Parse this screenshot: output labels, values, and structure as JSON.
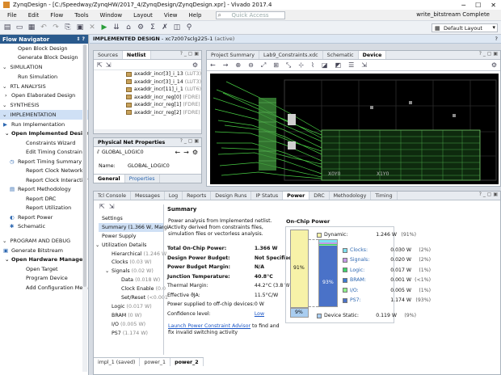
{
  "window": {
    "title": "ZynqDesign - [C:/Speedway/ZynqHW/2017_4/ZynqDesign/ZynqDesign.xpr] - Vivado 2017.4"
  },
  "menu": [
    "File",
    "Edit",
    "Flow",
    "Tools",
    "Window",
    "Layout",
    "View",
    "Help"
  ],
  "quick_access_placeholder": "Quick Access",
  "status_top": "write_bitstream Complete",
  "layout_select": "Default Layout",
  "flow_navigator": {
    "title": "Flow Navigator",
    "items": [
      {
        "label": "Open Block Design",
        "kind": "item",
        "indent": 22
      },
      {
        "label": "Generate Block Design",
        "kind": "item",
        "indent": 22
      },
      {
        "label": "SIMULATION",
        "kind": "section"
      },
      {
        "label": "Run Simulation",
        "kind": "item",
        "indent": 22
      },
      {
        "label": "RTL ANALYSIS",
        "kind": "section"
      },
      {
        "label": "Open Elaborated Design",
        "kind": "item",
        "indent": 14,
        "arrow": "›"
      },
      {
        "label": "SYNTHESIS",
        "kind": "section"
      },
      {
        "label": "IMPLEMENTATION",
        "kind": "section",
        "active": true
      },
      {
        "label": "Run Implementation",
        "kind": "item",
        "indent": 14,
        "icon": "▶"
      },
      {
        "label": "Open Implemented Design",
        "kind": "item",
        "indent": 14,
        "arrow": "⌄",
        "bold": true
      },
      {
        "label": "Constraints Wizard",
        "kind": "item",
        "indent": 32
      },
      {
        "label": "Edit Timing Constraints",
        "kind": "item",
        "indent": 32
      },
      {
        "label": "Report Timing Summary",
        "kind": "item",
        "indent": 22,
        "icon": "◷"
      },
      {
        "label": "Report Clock Networks",
        "kind": "item",
        "indent": 32
      },
      {
        "label": "Report Clock Interaction",
        "kind": "item",
        "indent": 32
      },
      {
        "label": "Report Methodology",
        "kind": "item",
        "indent": 22,
        "icon": "▤"
      },
      {
        "label": "Report DRC",
        "kind": "item",
        "indent": 32
      },
      {
        "label": "Report Utilization",
        "kind": "item",
        "indent": 32
      },
      {
        "label": "Report Power",
        "kind": "item",
        "indent": 22,
        "icon": "◐"
      },
      {
        "label": "Schematic",
        "kind": "item",
        "indent": 22,
        "icon": "✱"
      },
      {
        "label": "",
        "kind": "spacer"
      },
      {
        "label": "PROGRAM AND DEBUG",
        "kind": "section"
      },
      {
        "label": "Generate Bitstream",
        "kind": "item",
        "indent": 14,
        "icon": "▣"
      },
      {
        "label": "Open Hardware Manager",
        "kind": "item",
        "indent": 14,
        "arrow": "⌄",
        "bold": true
      },
      {
        "label": "Open Target",
        "kind": "item",
        "indent": 32
      },
      {
        "label": "Program Device",
        "kind": "item",
        "indent": 32
      },
      {
        "label": "Add Configuration Memory",
        "kind": "item",
        "indent": 32
      }
    ]
  },
  "impl_header": {
    "prefix": "IMPLEMENTED DESIGN",
    "part": "- xc7z007sclg225-1",
    "state": "(active)"
  },
  "netlist": {
    "tabs": [
      "Sources",
      "Netlist"
    ],
    "rows": [
      {
        "name": "axaddr_incr[3]_i_13",
        "type": "(LUT3)"
      },
      {
        "name": "axaddr_incr[3]_i_14",
        "type": "(LUT3)"
      },
      {
        "name": "axaddr_incr[11]_i_1",
        "type": "(LUT6)"
      },
      {
        "name": "axaddr_incr_reg[0]",
        "type": "(FDRE)"
      },
      {
        "name": "axaddr_incr_reg[1]",
        "type": "(FDRE)"
      },
      {
        "name": "axaddr_incr_reg[2]",
        "type": "(FDRE)"
      }
    ]
  },
  "net_props": {
    "title": "Physical Net Properties",
    "net": "GLOBAL_LOGIC0",
    "name_label": "Name:",
    "name_value": "GLOBAL_LOGIC0",
    "tabs": [
      "General",
      "Properties"
    ]
  },
  "view_tabs": [
    "Project Summary",
    "Lab9_Constraints.xdc",
    "Schematic",
    "Device"
  ],
  "device": {
    "label_left": "X0Y0",
    "label_right": "X1Y0"
  },
  "bottom_tabs": [
    "Tcl Console",
    "Messages",
    "Log",
    "Reports",
    "Design Runs",
    "IP Status",
    "Power",
    "DRC",
    "Methodology",
    "Timing"
  ],
  "power_tree": [
    {
      "label": "Settings",
      "level": 0
    },
    {
      "label": "Summary (1.366 W, Margi",
      "level": 0,
      "sel": true
    },
    {
      "label": "Power Supply",
      "level": 0
    },
    {
      "label": "Utilization Details",
      "level": 0,
      "arrow": "⌄"
    },
    {
      "label": "Hierarchical",
      "val": "(1.246 W",
      "level": 1
    },
    {
      "label": "Clocks",
      "val": "(0.03 W)",
      "level": 1
    },
    {
      "label": "Signals",
      "val": "(0.02 W)",
      "level": 1,
      "arrow": "⌄"
    },
    {
      "label": "Data",
      "val": "(0.018 W)",
      "level": 2
    },
    {
      "label": "Clock Enable",
      "val": "(0.0",
      "level": 2
    },
    {
      "label": "Set/Reset",
      "val": "(<0.001",
      "level": 2
    },
    {
      "label": "Logic",
      "val": "(0.017 W)",
      "level": 1
    },
    {
      "label": "BRAM",
      "val": "(0 W)",
      "level": 1
    },
    {
      "label": "I/O",
      "val": "(0.005 W)",
      "level": 1
    },
    {
      "label": "PS7",
      "val": "(1.174 W)",
      "level": 1
    }
  ],
  "summary": {
    "title": "Summary",
    "intro": "Power analysis from Implemented netlist. Activity derived from constraints files, simulation files or vectorless analysis.",
    "rows": [
      {
        "k": "Total On-Chip Power:",
        "v": "1.366 W",
        "bold": true
      },
      {
        "k": "Design Power Budget:",
        "v": "Not Specified",
        "bold": true
      },
      {
        "k": "Power Budget Margin:",
        "v": "N/A",
        "bold": true
      },
      {
        "k": "Junction Temperature:",
        "v": "40.8°C",
        "bold": true
      },
      {
        "k": "Thermal Margin:",
        "v": "44.2°C (3.8 W)",
        "bold": false
      },
      {
        "k": "Effective ϑJA:",
        "v": "11.5°C/W",
        "bold": false
      },
      {
        "k": "Power supplied to off-chip devices:",
        "v": "0 W",
        "bold": false
      },
      {
        "k": "Confidence level:",
        "v": "Low",
        "bold": false,
        "link": true
      }
    ],
    "advisor_link": "Launch Power Constraint Advisor",
    "advisor_rest": " to find and fix invalid switching activity"
  },
  "onchip": {
    "title": "On-Chip Power",
    "bar_dynamic_pct": "91%",
    "bar_static_pct": "9%",
    "inner_pct": "93%",
    "dynamic": {
      "label": "Dynamic:",
      "w": "1.246 W",
      "pct": "(91%)",
      "color": "#f7f2a8"
    },
    "items": [
      {
        "label": "Clocks:",
        "w": "0.030 W",
        "pct": "(2%)",
        "color": "#7fe0f0"
      },
      {
        "label": "Signals:",
        "w": "0.020 W",
        "pct": "(2%)",
        "color": "#c59ae8"
      },
      {
        "label": "Logic:",
        "w": "0.017 W",
        "pct": "(1%)",
        "color": "#3fd36b"
      },
      {
        "label": "BRAM:",
        "w": "0.001 W",
        "pct": "(<1%)",
        "color": "#3c7ad2"
      },
      {
        "label": "I/O:",
        "w": "0.005 W",
        "pct": "(1%)",
        "color": "#8ef08a"
      },
      {
        "label": "PS7:",
        "w": "1.174 W",
        "pct": "(93%)",
        "color": "#4a72c8"
      }
    ],
    "static": {
      "label": "Device Static:",
      "w": "0.119 W",
      "pct": "(9%)",
      "color": "#a9cdf0"
    }
  },
  "result_tabs": [
    "impl_1 (saved)",
    "power_1",
    "power_2"
  ]
}
